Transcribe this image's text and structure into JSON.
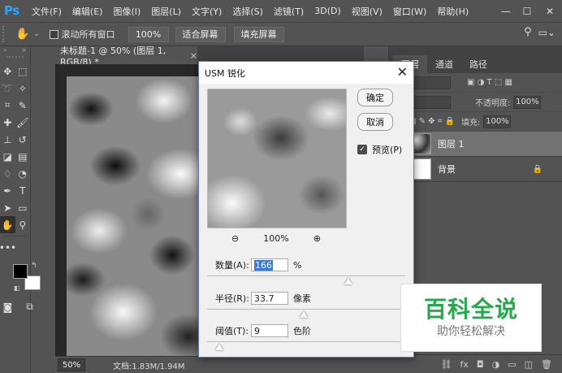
{
  "app": {
    "logo": "Ps"
  },
  "menu": [
    "文件(F)",
    "编辑(E)",
    "图像(I)",
    "图层(L)",
    "文字(Y)",
    "选择(S)",
    "滤镜(T)",
    "3D(D)",
    "视图(V)",
    "窗口(W)",
    "帮助(H)"
  ],
  "window_controls": {
    "minimize": "—",
    "maximize": "☐",
    "close": "✕"
  },
  "options": {
    "scroll_all_label": "滚动所有窗口",
    "zoom_100": "100%",
    "fit_screen": "适合屏幕",
    "fill_screen": "填充屏幕"
  },
  "document": {
    "tab_title": "未标题-1 @ 50% (图层 1, RGB/8) *",
    "close": "×",
    "zoom": "50%",
    "doc_info": "文档:1.83M/1.94M"
  },
  "panels": {
    "tabs": [
      "图层",
      "通道",
      "路径"
    ],
    "kind_label": "型",
    "opacity_label": "不透明度:",
    "opacity_value": "100%",
    "lock_label": "锁",
    "fill_label": "填充:",
    "fill_value": "100%",
    "layers": [
      {
        "name": "图层 1",
        "selected": true
      },
      {
        "name": "背景",
        "selected": false,
        "locked": true
      }
    ]
  },
  "dialog": {
    "title": "USM 锐化",
    "ok": "确定",
    "cancel": "取消",
    "preview_label": "预览(P)",
    "preview_checked": true,
    "zoom_level": "100%",
    "amount": {
      "label": "数量(A):",
      "value": "166",
      "unit": "%",
      "slider_fraction": 0.36
    },
    "radius": {
      "label": "半径(R):",
      "value": "33.7",
      "unit": "像素",
      "slider_fraction": 0.12
    },
    "threshold": {
      "label": "阈值(T):",
      "value": "9",
      "unit": "色阶",
      "slider_fraction": 0.04
    }
  },
  "watermark": {
    "main": "百科全说",
    "sub": "助你轻松解决"
  },
  "colors": {
    "ps_blue": "#2fa3f7",
    "watermark_green": "#27a84d",
    "ui_bg": "#535353"
  }
}
